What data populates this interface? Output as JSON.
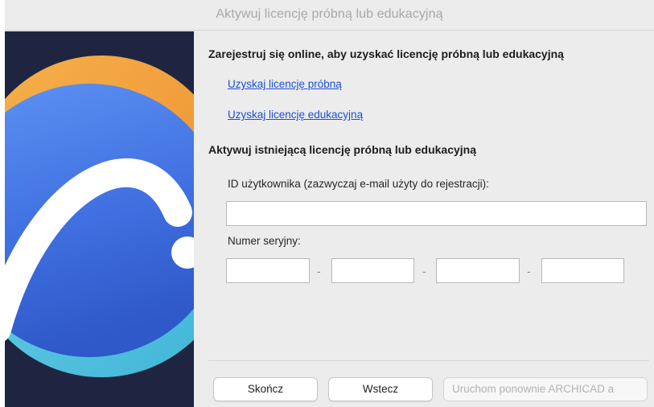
{
  "window": {
    "title": "Aktywuj licencję próbną lub edukacyjną"
  },
  "online": {
    "heading": "Zarejestruj się online, aby uzyskać licencję próbną lub edukacyjną",
    "trial_link": "Uzyskaj licencję próbną",
    "edu_link": "Uzyskaj licencję edukacyjną"
  },
  "activate": {
    "heading": "Aktywuj istniejącą licencję próbną lub edukacyjną",
    "user_id_label": "ID użytkownika (zazwyczaj e-mail użyty do rejestracji):",
    "user_id_value": "",
    "serial_label": "Numer seryjny:",
    "serial_separator": "-",
    "serial_values": [
      "",
      "",
      "",
      ""
    ]
  },
  "buttons": {
    "finish": "Skończ",
    "back": "Wstecz",
    "restart": "Uruchom ponownie ARCHICAD a"
  },
  "colors": {
    "art_background": "#1f2540",
    "art_blue": "#4f86ee",
    "art_orange": "#f39c3b",
    "art_cyan": "#4ec2dd",
    "link": "#1a4fd8"
  },
  "icons": {
    "artwork": "archicad-logo-artwork"
  }
}
